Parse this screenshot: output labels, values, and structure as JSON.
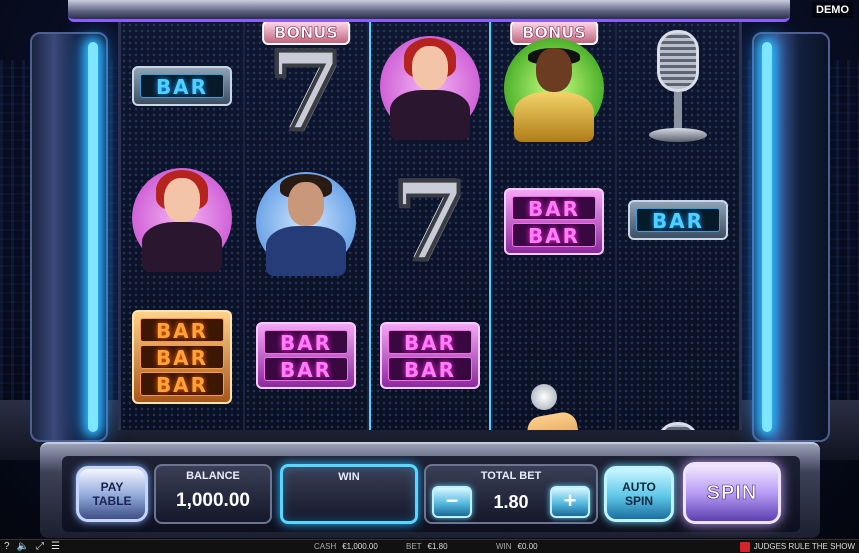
{
  "demo_badge": "DEMO",
  "reels": [
    {
      "symbols": [
        "BAR",
        "redhead-judge",
        "BAR BAR BAR"
      ]
    },
    {
      "symbols": [
        "BONUS",
        "seven",
        "bearded-judge",
        "BAR BAR"
      ]
    },
    {
      "symbols": [
        "redhead-judge",
        "seven",
        "BAR BAR"
      ]
    },
    {
      "symbols": [
        "BONUS",
        "gold-judge",
        "BAR BAR",
        "golden-mic",
        "BONUS"
      ]
    },
    {
      "symbols": [
        "microphone",
        "BAR",
        "microphone"
      ]
    }
  ],
  "symbol_text": {
    "bar": "BAR",
    "bonus": "BONUS",
    "seven": "7"
  },
  "controls": {
    "paytable_label": "PAY TABLE",
    "balance_label": "BALANCE",
    "balance_value": "1,000.00",
    "win_label": "WIN",
    "win_value": "",
    "totalbet_label": "TOTAL BET",
    "totalbet_value": "1.80",
    "minus_label": "−",
    "plus_label": "+",
    "autospin_label": "AUTO SPIN",
    "spin_label": "SPIN"
  },
  "status_bar": {
    "cash_label": "CASH",
    "cash_value": "€1,000.00",
    "bet_label": "BET",
    "bet_value": "€1.80",
    "win_label": "WIN",
    "win_value": "€0.00",
    "game_title": "JUDGES RULE THE SHOW",
    "icons": [
      "help-icon",
      "sound-icon",
      "fullscreen-icon",
      "menu-icon"
    ]
  },
  "colors": {
    "neon_blue": "#2fb8ff",
    "spin_purple": "#b89df5",
    "bar_blue": "#4fd0ff",
    "bar_pink": "#ff7ef8",
    "bar_orange": "#ffa23a"
  }
}
